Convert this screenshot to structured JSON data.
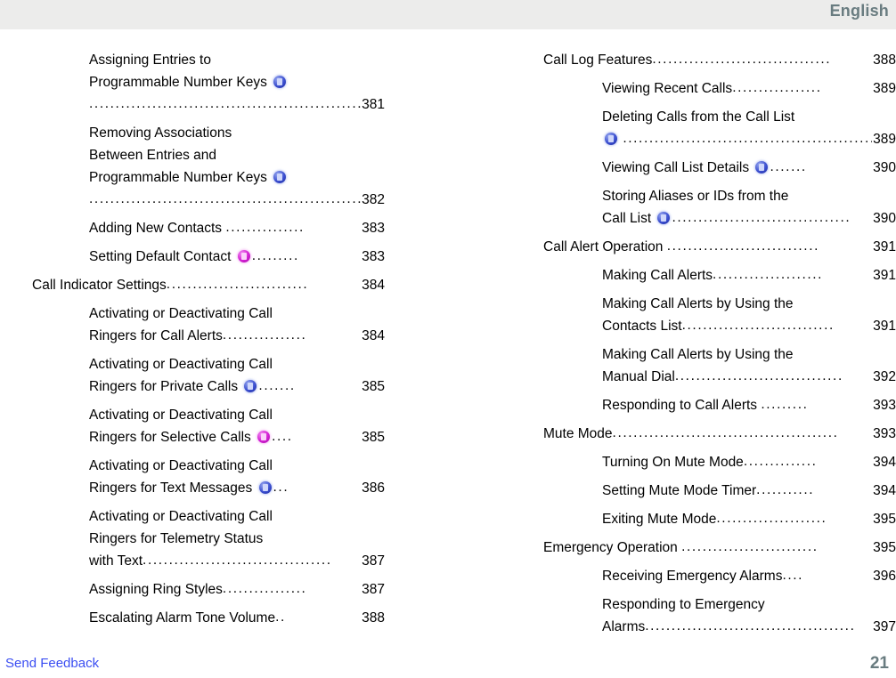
{
  "header": {
    "language_label": "English",
    "background_color": "#ececeb",
    "text_color": "#697c80"
  },
  "footer": {
    "feedback_label": "Send Feedback",
    "feedback_color": "#3b4ef2",
    "page_number": "21",
    "page_number_color": "#697c80"
  },
  "icons": {
    "blue_badge": "blue-circle-badge-icon",
    "magenta_badge": "magenta-circle-badge-icon",
    "blue_color": "#3b4fd0",
    "magenta_color": "#d21fd2"
  },
  "toc": {
    "left_column": [
      {
        "level": 2,
        "lines": [
          "Assigning Entries to"
        ],
        "tail_text": "Programmable Number Keys ",
        "icon": "blue",
        "icon_on_own_line_below": true,
        "leader_text": "....................................................",
        "page": "381"
      },
      {
        "level": 2,
        "lines": [
          "Removing Associations",
          "Between Entries and"
        ],
        "tail_text": "Programmable Number Keys ",
        "icon": "blue",
        "icon_on_own_line_below": true,
        "leader_text": "....................................................",
        "page": "382"
      },
      {
        "level": 2,
        "lines": [],
        "tail_text": "Adding New Contacts ",
        "icon": null,
        "leader_text": "...............",
        "page": "383"
      },
      {
        "level": 2,
        "lines": [],
        "tail_text": "Setting Default Contact ",
        "icon": "magenta",
        "leader_text": ".........",
        "page": "383"
      },
      {
        "level": 1,
        "lines": [],
        "tail_text": "Call Indicator Settings",
        "icon": null,
        "leader_text": "...........................",
        "page": "384"
      },
      {
        "level": 2,
        "lines": [
          "Activating or Deactivating Call"
        ],
        "tail_text": "Ringers for Call Alerts",
        "icon": null,
        "leader_text": "................",
        "page": "384"
      },
      {
        "level": 2,
        "lines": [
          "Activating or Deactivating Call"
        ],
        "tail_text": "Ringers for Private Calls ",
        "icon": "blue",
        "leader_text": ".......",
        "page": "385"
      },
      {
        "level": 2,
        "lines": [
          "Activating or Deactivating Call"
        ],
        "tail_text": "Ringers for Selective Calls ",
        "icon": "magenta",
        "leader_text": "....",
        "page": "385"
      },
      {
        "level": 2,
        "lines": [
          "Activating or Deactivating Call"
        ],
        "tail_text": "Ringers for Text Messages ",
        "icon": "blue",
        "leader_text": "...",
        "page": "386"
      },
      {
        "level": 2,
        "lines": [
          "Activating or Deactivating Call",
          "Ringers for Telemetry Status"
        ],
        "tail_text": "with Text",
        "icon": null,
        "leader_text": "....................................",
        "page": "387"
      },
      {
        "level": 2,
        "lines": [],
        "tail_text": "Assigning Ring Styles",
        "icon": null,
        "leader_text": "................",
        "page": "387"
      },
      {
        "level": 2,
        "lines": [],
        "tail_text": "Escalating Alarm Tone Volume",
        "icon": null,
        "leader_text": "..",
        "page": "388"
      }
    ],
    "right_column": [
      {
        "level": 1,
        "lines": [],
        "tail_text": "Call Log Features",
        "icon": null,
        "leader_text": "..................................",
        "page": "388"
      },
      {
        "level": 2,
        "lines": [],
        "tail_text": "Viewing Recent Calls",
        "icon": null,
        "leader_text": ".................",
        "page": "389"
      },
      {
        "level": 2,
        "lines": [
          "Deleting Calls from the Call List"
        ],
        "tail_text": "",
        "icon": "blue",
        "icon_leading": true,
        "leader_text": "................................................",
        "page": "389"
      },
      {
        "level": 2,
        "lines": [],
        "tail_text": "Viewing Call List Details ",
        "icon": "blue",
        "leader_text": ".......",
        "page": "390"
      },
      {
        "level": 2,
        "lines": [
          "Storing Aliases or IDs from the"
        ],
        "tail_text": "Call List ",
        "icon": "blue",
        "leader_text": "..................................",
        "page": "390"
      },
      {
        "level": 1,
        "lines": [],
        "tail_text": "Call Alert Operation ",
        "icon": null,
        "leader_text": ".............................",
        "page": "391"
      },
      {
        "level": 2,
        "lines": [],
        "tail_text": "Making Call Alerts",
        "icon": null,
        "leader_text": ".....................",
        "page": "391"
      },
      {
        "level": 2,
        "lines": [
          "Making Call Alerts by Using the"
        ],
        "tail_text": "Contacts List",
        "icon": null,
        "leader_text": ".............................",
        "page": "391"
      },
      {
        "level": 2,
        "lines": [
          "Making Call Alerts by Using the"
        ],
        "tail_text": "Manual Dial",
        "icon": null,
        "leader_text": "................................",
        "page": "392"
      },
      {
        "level": 2,
        "lines": [],
        "tail_text": "Responding to Call Alerts ",
        "icon": null,
        "leader_text": ".........",
        "page": "393"
      },
      {
        "level": 1,
        "lines": [],
        "tail_text": "Mute Mode",
        "icon": null,
        "leader_text": "...........................................",
        "page": "393"
      },
      {
        "level": 2,
        "lines": [],
        "tail_text": "Turning On Mute Mode",
        "icon": null,
        "leader_text": "..............",
        "page": "394"
      },
      {
        "level": 2,
        "lines": [],
        "tail_text": "Setting Mute Mode Timer",
        "icon": null,
        "leader_text": "...........",
        "page": "394"
      },
      {
        "level": 2,
        "lines": [],
        "tail_text": "Exiting Mute Mode",
        "icon": null,
        "leader_text": ".....................",
        "page": "395"
      },
      {
        "level": 1,
        "lines": [],
        "tail_text": "Emergency Operation ",
        "icon": null,
        "leader_text": "..........................",
        "page": "395"
      },
      {
        "level": 2,
        "lines": [],
        "tail_text": "Receiving Emergency Alarms",
        "icon": null,
        "leader_text": "....",
        "page": "396"
      },
      {
        "level": 2,
        "lines": [
          "Responding to Emergency"
        ],
        "tail_text": "Alarms",
        "icon": null,
        "leader_text": "........................................",
        "page": "397"
      }
    ]
  }
}
